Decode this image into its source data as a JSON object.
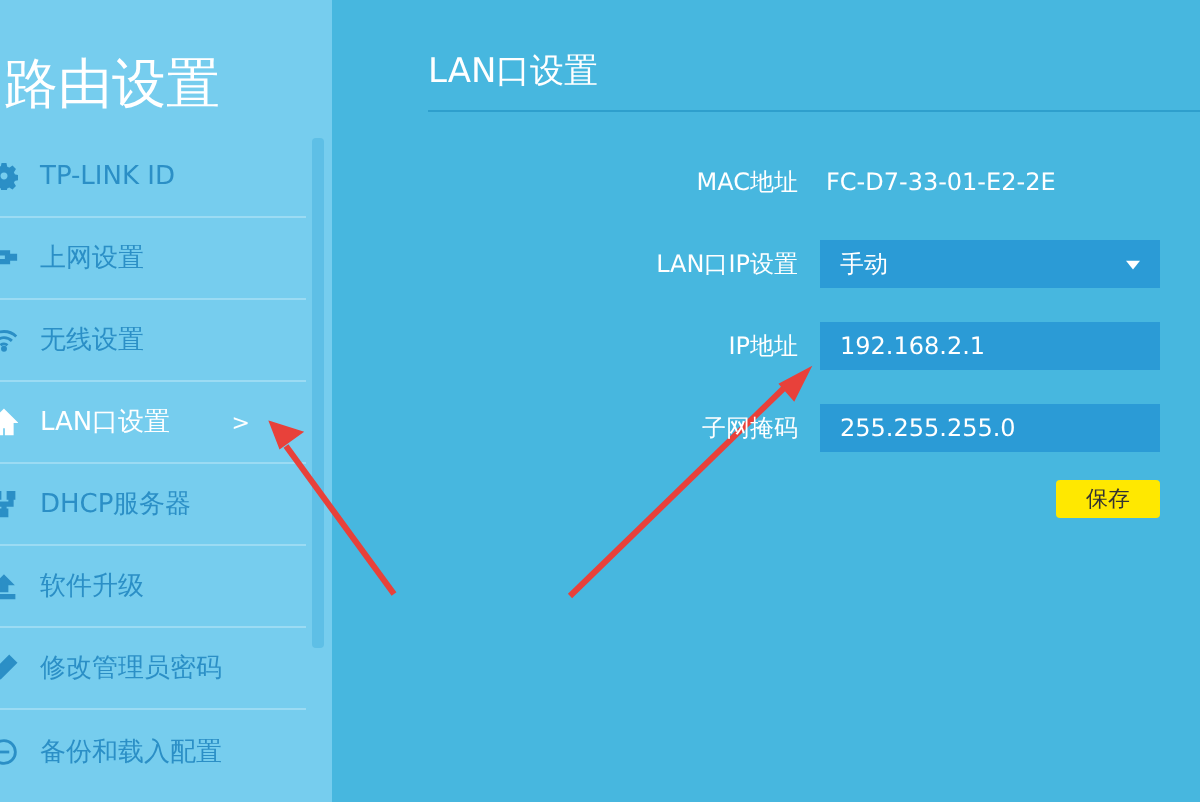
{
  "sidebar": {
    "title": "路由设置",
    "items": [
      {
        "label": "TP-LINK ID",
        "selected": false
      },
      {
        "label": "上网设置",
        "selected": false
      },
      {
        "label": "无线设置",
        "selected": false
      },
      {
        "label": "LAN口设置",
        "selected": true,
        "chevron": ">"
      },
      {
        "label": "DHCP服务器",
        "selected": false
      },
      {
        "label": "软件升级",
        "selected": false
      },
      {
        "label": "修改管理员密码",
        "selected": false
      },
      {
        "label": "备份和载入配置",
        "selected": false
      }
    ]
  },
  "panel": {
    "title": "LAN口设置",
    "fields": [
      {
        "label": "MAC地址",
        "kind": "text",
        "value": "FC-D7-33-01-E2-2E"
      },
      {
        "label": "LAN口IP设置",
        "kind": "select",
        "value": "手动"
      },
      {
        "label": "IP地址",
        "kind": "input",
        "value": "192.168.2.1"
      },
      {
        "label": "子网掩码",
        "kind": "input",
        "value": "255.255.255.0"
      }
    ],
    "save_button": "保存"
  }
}
